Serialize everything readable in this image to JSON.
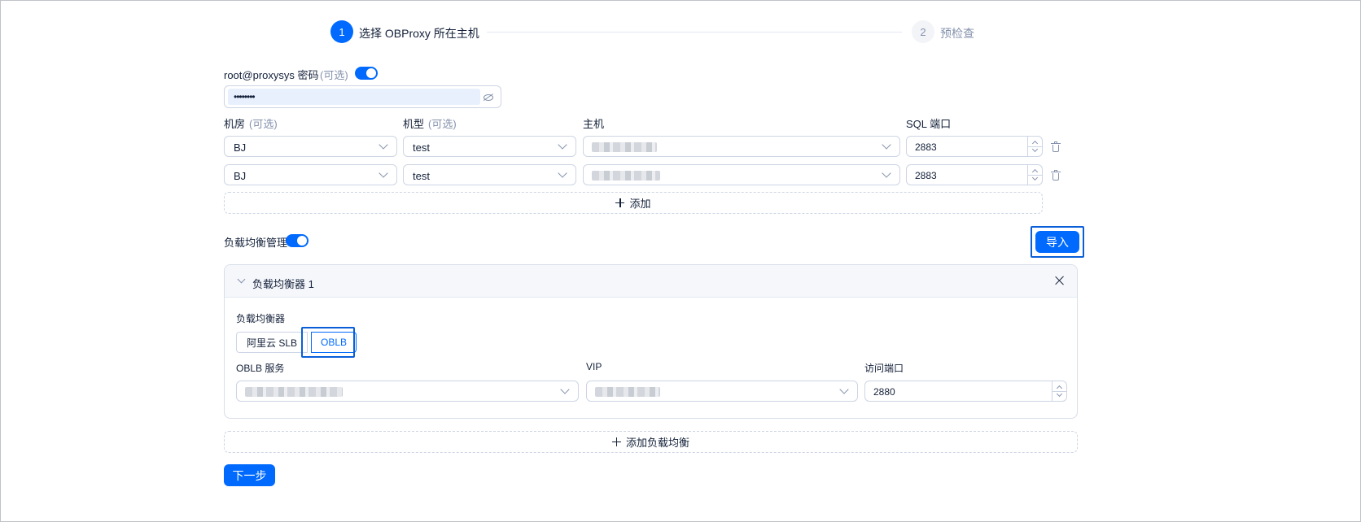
{
  "steps": [
    {
      "index": "1",
      "label": "选择 OBProxy 所在主机",
      "status": "active"
    },
    {
      "index": "2",
      "label": "预检查",
      "status": "wait"
    }
  ],
  "password": {
    "label": "root@proxysys 密码",
    "optional": "(可选)",
    "switch_on": true,
    "masked_value": "••••••••"
  },
  "hosts_table": {
    "columns": [
      {
        "label": "机房",
        "optional": "(可选)"
      },
      {
        "label": "机型",
        "optional": "(可选)"
      },
      {
        "label": "主机",
        "optional": ""
      },
      {
        "label": "SQL 端口",
        "optional": ""
      }
    ],
    "rows": [
      {
        "idc": "BJ",
        "model": "test",
        "host": "",
        "port": "2883"
      },
      {
        "idc": "BJ",
        "model": "test",
        "host": "",
        "port": "2883"
      }
    ],
    "add_label": "添加"
  },
  "lb": {
    "label": "负载均衡管理",
    "switch_on": true,
    "import_label": "导入",
    "panel_title": "负载均衡器 1",
    "field_label": "负载均衡器",
    "options": [
      "阿里云 SLB",
      "OBLB"
    ],
    "selected": "OBLB",
    "service_label": "OBLB 服务",
    "vip_label": "VIP",
    "port_label": "访问端口",
    "port_value": "2880",
    "add_label": "添加负载均衡"
  },
  "next_label": "下一步",
  "colors": {
    "primary": "#006aff",
    "border": "#cdd5e4",
    "text": "#132039",
    "muted": "#8592ad"
  },
  "icons": [
    "chevron-down-icon",
    "trash-icon",
    "plus-icon",
    "eye-invisible-icon",
    "close-icon",
    "caret-up-icon",
    "caret-down-icon"
  ]
}
